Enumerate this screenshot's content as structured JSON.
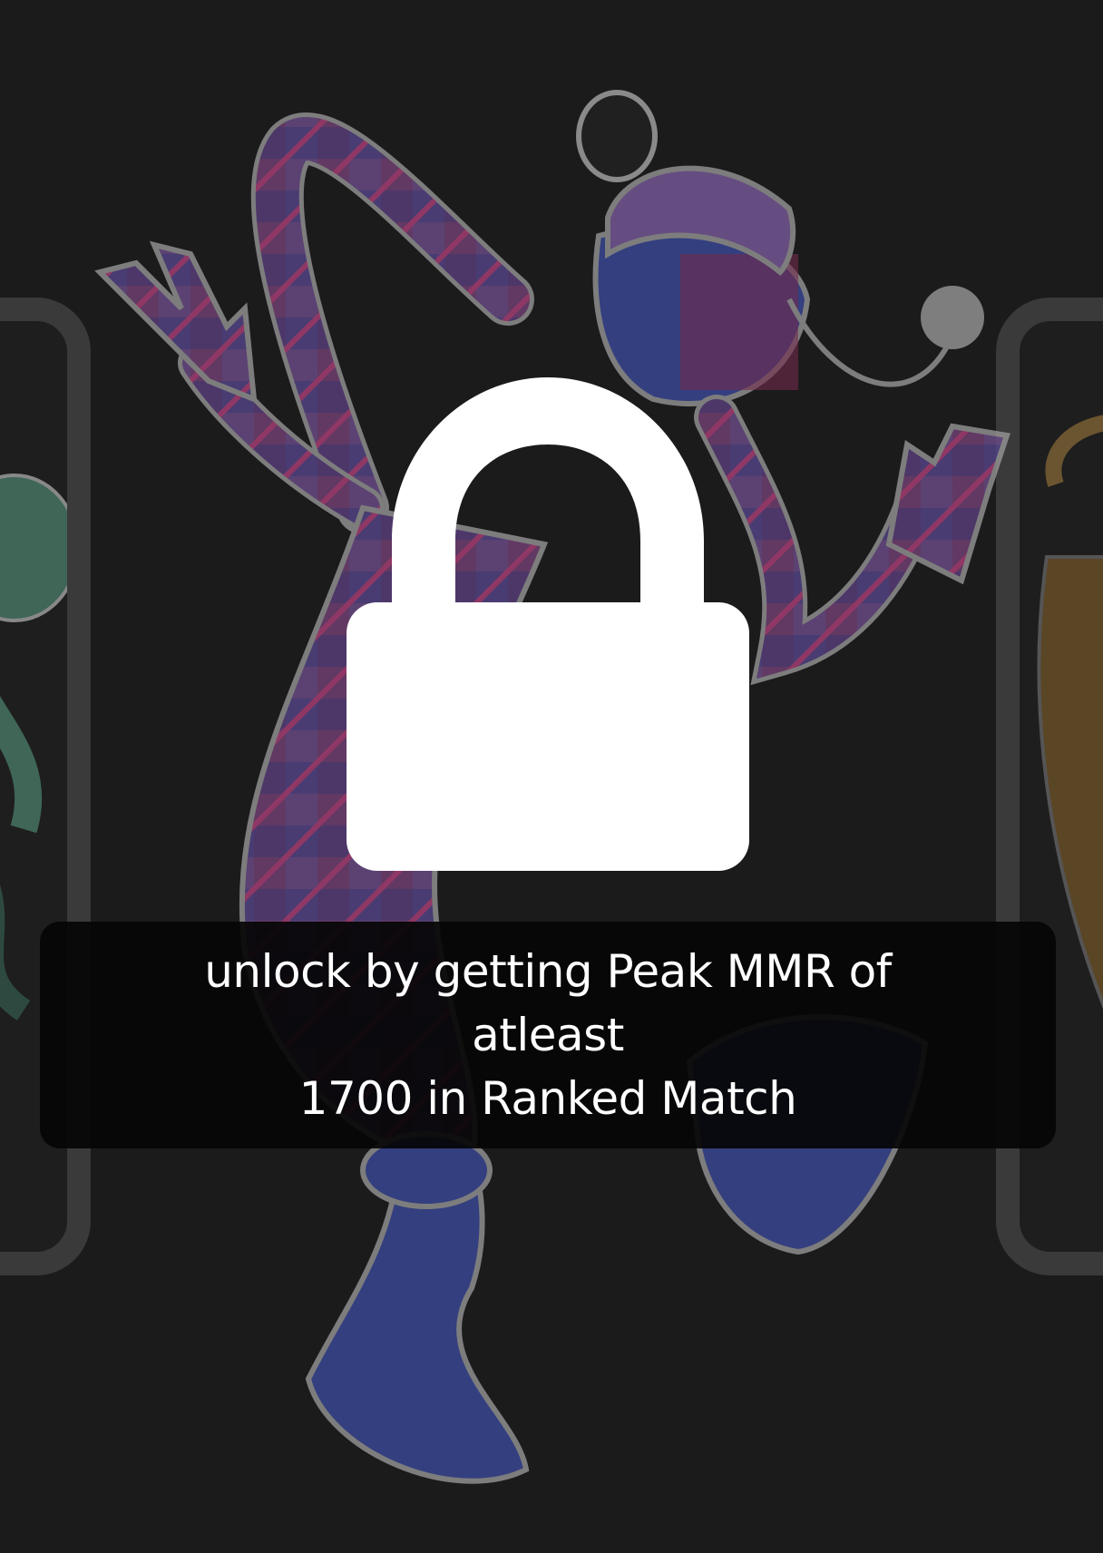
{
  "lock": {
    "icon": "lock-icon",
    "requirement_text": "unlock by getting  Peak  MMR of atleast\n1700 in  Ranked  Match"
  },
  "colors": {
    "background": "#1b1b1b",
    "card_border": "#3a3a3a",
    "banner_bg": "#050505",
    "lock": "#ffffff",
    "character_blue": "#3b4a9c",
    "character_purple": "#8a5fa8",
    "character_pink": "#b0407a"
  }
}
